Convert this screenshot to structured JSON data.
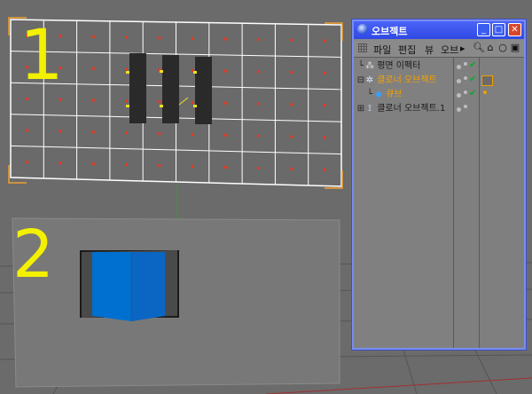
{
  "viewport": {
    "label_1": "1",
    "label_2": "2",
    "grid_columns": 10,
    "grid_rows": 5,
    "colors": {
      "background": "#6b6b6b",
      "grid_line": "#ffffff",
      "grid_point": "#e8361e",
      "selection_bracket": "#f0a030",
      "cube": "#0070d0",
      "label": "#f3f000"
    }
  },
  "object_manager": {
    "title": "오브젝트",
    "window_buttons": {
      "minimize": "_",
      "maximize": "□",
      "close": "✕"
    },
    "menu": [
      "파일",
      "편집",
      "뷰",
      "오브"
    ],
    "menu_more_glyph": "▸",
    "toolbar_icons": [
      "search-icon",
      "home-icon",
      "view-icon",
      "new-window-icon"
    ],
    "objects": [
      {
        "name": "평면 이펙터",
        "icon": "effector-icon",
        "color": "#1b1b1b",
        "indent": 0
      },
      {
        "name": "클로너 오브젝트",
        "icon": "cloner-icon",
        "color": "#f5a000",
        "indent": 0
      },
      {
        "name": "큐브",
        "icon": "cube-icon",
        "color": "#f5a000",
        "indent": 1
      },
      {
        "name": "클로너 오브젝트.1",
        "icon": "cloner-icon",
        "color": "#1b1b1b",
        "indent": 0
      }
    ]
  }
}
